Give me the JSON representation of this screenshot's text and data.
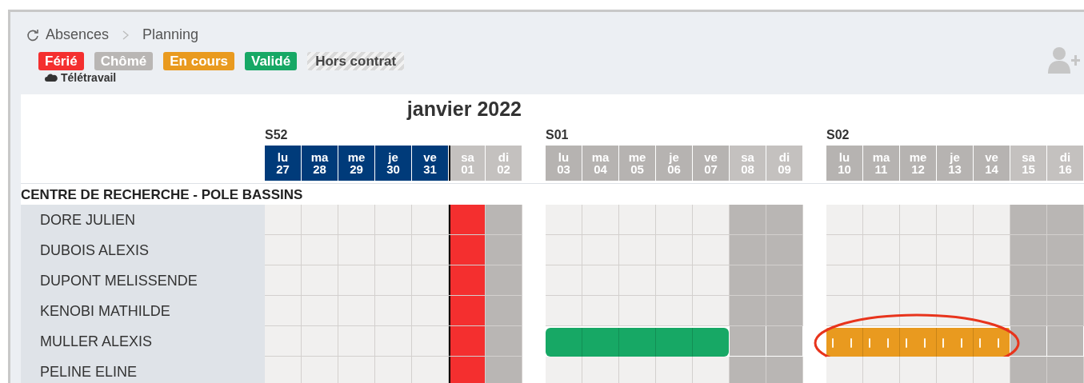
{
  "breadcrumb": [
    "Absences",
    "Planning"
  ],
  "legend": [
    {
      "label": "Férié",
      "kind": "solid",
      "color": "#f42f2f"
    },
    {
      "label": "Chômé",
      "kind": "solid",
      "color": "#b9b6b4"
    },
    {
      "label": "En cours",
      "kind": "solid",
      "color": "#e99a1f"
    },
    {
      "label": "Validé",
      "kind": "solid",
      "color": "#17a865"
    },
    {
      "label": "Hors contrat",
      "kind": "hatched",
      "color": "#d9d9d9"
    },
    {
      "label": "Télétravail",
      "kind": "cloud"
    }
  ],
  "month": "janvier 2022",
  "weeks": [
    {
      "label": "S52",
      "days": [
        {
          "abbr": "lu",
          "num": "27",
          "kind": "worked",
          "current": true,
          "marker_before": false
        },
        {
          "abbr": "ma",
          "num": "28",
          "kind": "worked",
          "current": true,
          "marker_before": false
        },
        {
          "abbr": "me",
          "num": "29",
          "kind": "worked",
          "current": true,
          "marker_before": false
        },
        {
          "abbr": "je",
          "num": "30",
          "kind": "worked",
          "current": true,
          "marker_before": false
        },
        {
          "abbr": "ve",
          "num": "31",
          "kind": "worked",
          "current": true,
          "marker_before": false
        },
        {
          "abbr": "sa",
          "num": "01",
          "kind": "holiday",
          "current": false,
          "marker_before": true
        },
        {
          "abbr": "di",
          "num": "02",
          "kind": "weekend",
          "current": false,
          "marker_before": false
        }
      ]
    },
    {
      "label": "S01",
      "days": [
        {
          "abbr": "lu",
          "num": "03",
          "kind": "worked",
          "current": false,
          "marker_before": false
        },
        {
          "abbr": "ma",
          "num": "04",
          "kind": "worked",
          "current": false,
          "marker_before": false
        },
        {
          "abbr": "me",
          "num": "05",
          "kind": "worked",
          "current": false,
          "marker_before": false
        },
        {
          "abbr": "je",
          "num": "06",
          "kind": "worked",
          "current": false,
          "marker_before": false
        },
        {
          "abbr": "ve",
          "num": "07",
          "kind": "worked",
          "current": false,
          "marker_before": false
        },
        {
          "abbr": "sa",
          "num": "08",
          "kind": "weekend",
          "current": false,
          "marker_before": false
        },
        {
          "abbr": "di",
          "num": "09",
          "kind": "weekend",
          "current": false,
          "marker_before": false
        }
      ]
    },
    {
      "label": "S02",
      "days": [
        {
          "abbr": "lu",
          "num": "10",
          "kind": "worked",
          "current": false,
          "marker_before": false
        },
        {
          "abbr": "ma",
          "num": "11",
          "kind": "worked",
          "current": false,
          "marker_before": false
        },
        {
          "abbr": "me",
          "num": "12",
          "kind": "worked",
          "current": false,
          "marker_before": false
        },
        {
          "abbr": "je",
          "num": "13",
          "kind": "worked",
          "current": false,
          "marker_before": false
        },
        {
          "abbr": "ve",
          "num": "14",
          "kind": "worked",
          "current": false,
          "marker_before": false
        },
        {
          "abbr": "sa",
          "num": "15",
          "kind": "weekend",
          "current": false,
          "marker_before": false
        },
        {
          "abbr": "di",
          "num": "16",
          "kind": "weekend",
          "current": false,
          "marker_before": false
        }
      ]
    }
  ],
  "group": {
    "title": "CENTRE DE RECHERCHE - POLE BASSINS",
    "people": [
      {
        "name": "DORE JULIEN",
        "weeks": [
          {
            "validated": false,
            "pending": false,
            "circled": false
          },
          {
            "validated": false,
            "pending": false,
            "circled": false
          },
          {
            "validated": false,
            "pending": false,
            "circled": false
          }
        ]
      },
      {
        "name": "DUBOIS ALEXIS",
        "weeks": [
          {
            "validated": false,
            "pending": false,
            "circled": false
          },
          {
            "validated": false,
            "pending": false,
            "circled": false
          },
          {
            "validated": false,
            "pending": false,
            "circled": false
          }
        ]
      },
      {
        "name": "DUPONT MELISSENDE",
        "weeks": [
          {
            "validated": false,
            "pending": false,
            "circled": false
          },
          {
            "validated": false,
            "pending": false,
            "circled": false
          },
          {
            "validated": false,
            "pending": false,
            "circled": false
          }
        ]
      },
      {
        "name": "KENOBI MATHILDE",
        "weeks": [
          {
            "validated": false,
            "pending": false,
            "circled": false
          },
          {
            "validated": false,
            "pending": false,
            "circled": false
          },
          {
            "validated": false,
            "pending": false,
            "circled": false
          }
        ]
      },
      {
        "name": "MULLER ALEXIS",
        "weeks": [
          {
            "validated": false,
            "pending": false,
            "circled": false
          },
          {
            "validated": true,
            "pending": false,
            "circled": false
          },
          {
            "validated": false,
            "pending": true,
            "circled": true
          }
        ]
      },
      {
        "name": "PELINE ELINE",
        "weeks": [
          {
            "validated": false,
            "pending": false,
            "circled": false
          },
          {
            "validated": false,
            "pending": false,
            "circled": false
          },
          {
            "validated": false,
            "pending": false,
            "circled": false
          }
        ]
      }
    ]
  }
}
